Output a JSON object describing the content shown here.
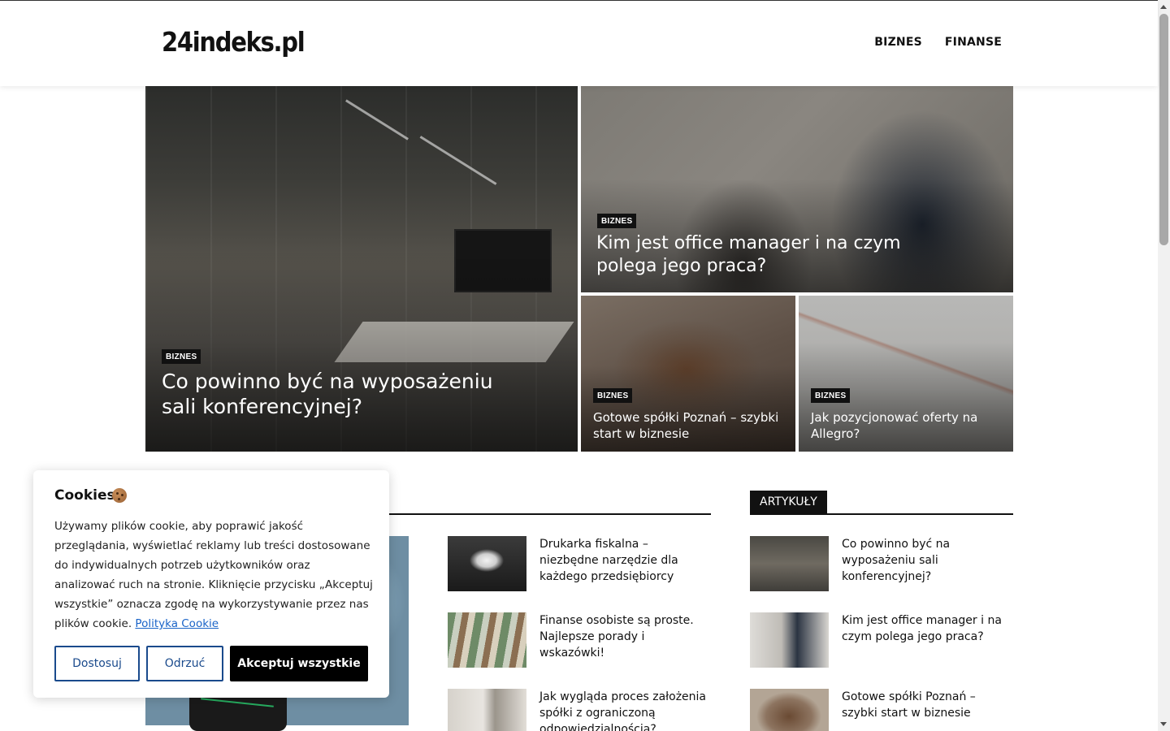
{
  "header": {
    "logo": "24indeks.pl",
    "nav": [
      {
        "label": "BIZNES"
      },
      {
        "label": "FINANSE"
      }
    ]
  },
  "hero": {
    "main": {
      "badge": "BIZNES",
      "title": "Co powinno być na wyposażeniu sali konferencyjnej?"
    },
    "top_right": {
      "badge": "BIZNES",
      "title": "Kim jest office manager i na czym polega jego praca?"
    },
    "bottom_left": {
      "badge": "BIZNES",
      "title": "Gotowe spółki Poznań – szybki start w biznesie"
    },
    "bottom_right": {
      "badge": "BIZNES",
      "title": "Jak pozycjonować oferty na Allegro?"
    }
  },
  "latest": {
    "items": [
      {
        "title": "Drukarka fiskalna – niezbędne narzędzie dla każdego przedsiębiorcy"
      },
      {
        "title": "Finanse osobiste są proste. Najlepsze porady i wskazówki!"
      },
      {
        "title": "Jak wygląda proces założenia spółki z ograniczoną odpowiedzialnością?"
      }
    ]
  },
  "sidebar": {
    "heading": "ARTYKUŁY",
    "items": [
      {
        "title": "Co powinno być na wyposażeniu sali konferencyjnej?"
      },
      {
        "title": "Kim jest office manager i na czym polega jego praca?"
      },
      {
        "title": "Gotowe spółki Poznań – szybki start w biznesie"
      }
    ]
  },
  "cookie": {
    "title": "Cookies",
    "text": "Używamy plików cookie, aby poprawić jakość przeglądania, wyświetlać reklamy lub treści dostosowane do indywidualnych potrzeb użytkowników oraz analizować ruch na stronie. Kliknięcie przycisku „Akceptuj wszystkie” oznacza zgodę na wykorzystywanie przez nas plików cookie.",
    "link": "Polityka Cookie",
    "customize": "Dostosuj",
    "reject": "Odrzuć",
    "accept": "Akceptuj wszystkie"
  }
}
